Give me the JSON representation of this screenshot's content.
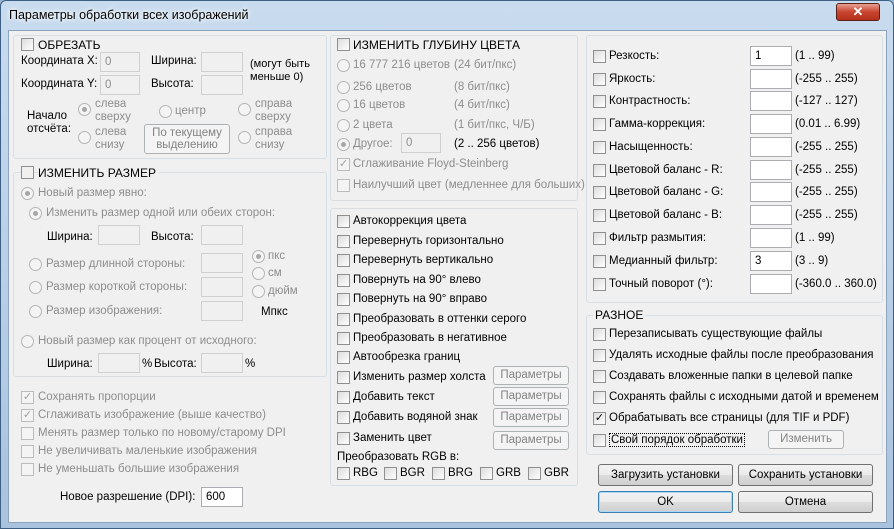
{
  "window": {
    "title": "Параметры обработки всех изображений",
    "close_glyph": "✕"
  },
  "crop": {
    "heading": "ОБРЕЗАТЬ",
    "coord_x": "Координата X:",
    "coord_x_val": "0",
    "coord_y": "Координата Y:",
    "coord_y_val": "0",
    "width": "Ширина:",
    "height": "Высота:",
    "note1": "(могут быть",
    "note2": "меньше 0)",
    "origin1": "Начало",
    "origin2": "отсчёта:",
    "top_left1": "слева",
    "top_left2": "сверху",
    "center": "центр",
    "top_right1": "справа",
    "top_right2": "сверху",
    "bottom_left1": "слева",
    "bottom_left2": "снизу",
    "by_selection1": "По текущему",
    "by_selection2": "выделению",
    "bottom_right1": "справа",
    "bottom_right2": "снизу"
  },
  "resize": {
    "heading": "ИЗМЕНИТЬ РАЗМЕР",
    "explicit": "Новый размер явно:",
    "one_or_both": "Изменить размер одной или обеих сторон:",
    "width": "Ширина:",
    "height": "Высота:",
    "long_side": "Размер длинной стороны:",
    "short_side": "Размер короткой стороны:",
    "image_size": "Размер изображения:",
    "units_px": "пкс",
    "units_cm": "см",
    "units_in": "дюйм",
    "mpx": "Мпкс",
    "percent": "Новый размер как процент от исходного:",
    "pct_width": "Ширина:",
    "pct_height": "Высота:",
    "pct": "%",
    "keep_proportions": "Сохранять пропорции",
    "smooth": "Сглаживать изображение (выше качество)",
    "dpi_only": "Менять размер только по новому/старому DPI",
    "no_enlarge": "Не увеличивать маленькие изображения",
    "no_reduce": "Не уменьшать большие изображения",
    "new_dpi": "Новое разрешение (DPI):",
    "new_dpi_val": "600"
  },
  "color_depth": {
    "heading": "ИЗМЕНИТЬ ГЛУБИНУ ЦВЕТА",
    "options": [
      {
        "label": "16 777 216 цветов",
        "desc": "(24 бит/пкс)"
      },
      {
        "label": "256 цветов",
        "desc": "(8 бит/пкс)"
      },
      {
        "label": "16 цветов",
        "desc": "(4 бит/пкс)"
      },
      {
        "label": "2 цвета",
        "desc": "(1 бит/пкс, Ч/Б)"
      }
    ],
    "other": "Другое:",
    "other_val": "0",
    "other_desc": "(2 .. 256 цветов)",
    "floyd": "Сглаживание Floyd-Steinberg",
    "best_color": "Наилучший цвет (медленнее для больших)"
  },
  "transforms": {
    "auto_color": "Автокоррекция цвета",
    "flip_h": "Перевернуть горизонтально",
    "flip_v": "Перевернуть вертикально",
    "rot_left": "Повернуть на 90° влево",
    "rot_right": "Повернуть на 90° вправо",
    "grayscale": "Преобразовать в оттенки серого",
    "negative": "Преобразовать в негативное",
    "autocrop": "Автообрезка границ",
    "canvas": "Изменить размер холста",
    "add_text": "Добавить текст",
    "watermark": "Добавить водяной знак",
    "replace_color": "Заменить цвет",
    "params": "Параметры",
    "rgb_label": "Преобразовать RGB в:",
    "rgb_options": [
      "RBG",
      "BGR",
      "BRG",
      "GRB",
      "GBR"
    ]
  },
  "adjustments": [
    {
      "label": "Резкость:",
      "value": "1",
      "range": "(1 .. 99)"
    },
    {
      "label": "Яркость:",
      "value": "",
      "range": "(-255 .. 255)"
    },
    {
      "label": "Контрастность:",
      "value": "",
      "range": "(-127 .. 127)"
    },
    {
      "label": "Гамма-коррекция:",
      "value": "",
      "range": "(0.01 .. 6.99)"
    },
    {
      "label": "Насыщенность:",
      "value": "",
      "range": "(-255 .. 255)"
    },
    {
      "label": "Цветовой баланс - R:",
      "value": "",
      "range": "(-255 .. 255)"
    },
    {
      "label": "Цветовой баланс - G:",
      "value": "",
      "range": "(-255 .. 255)"
    },
    {
      "label": "Цветовой баланс - B:",
      "value": "",
      "range": "(-255 .. 255)"
    },
    {
      "label": "Фильтр размытия:",
      "value": "",
      "range": "(1 .. 99)"
    },
    {
      "label": "Медианный фильтр:",
      "value": "3",
      "range": "(3 .. 9)"
    },
    {
      "label": "Точный поворот (°):",
      "value": "",
      "range": "(-360.0 .. 360.0)"
    }
  ],
  "misc": {
    "heading": "РАЗНОЕ",
    "overwrite": "Перезаписывать существующие файлы",
    "delete_src": "Удалять исходные файлы после преобразования",
    "subfolders": "Создавать вложенные папки в целевой папке",
    "keep_dates": "Сохранять файлы с исходными датой и временем",
    "all_pages": "Обрабатывать все страницы (для TIF и PDF)",
    "own_order": "Свой порядок обработки",
    "change": "Изменить"
  },
  "footer": {
    "load": "Загрузить установки",
    "save": "Сохранить установки",
    "ok": "OK",
    "cancel": "Отмена"
  }
}
